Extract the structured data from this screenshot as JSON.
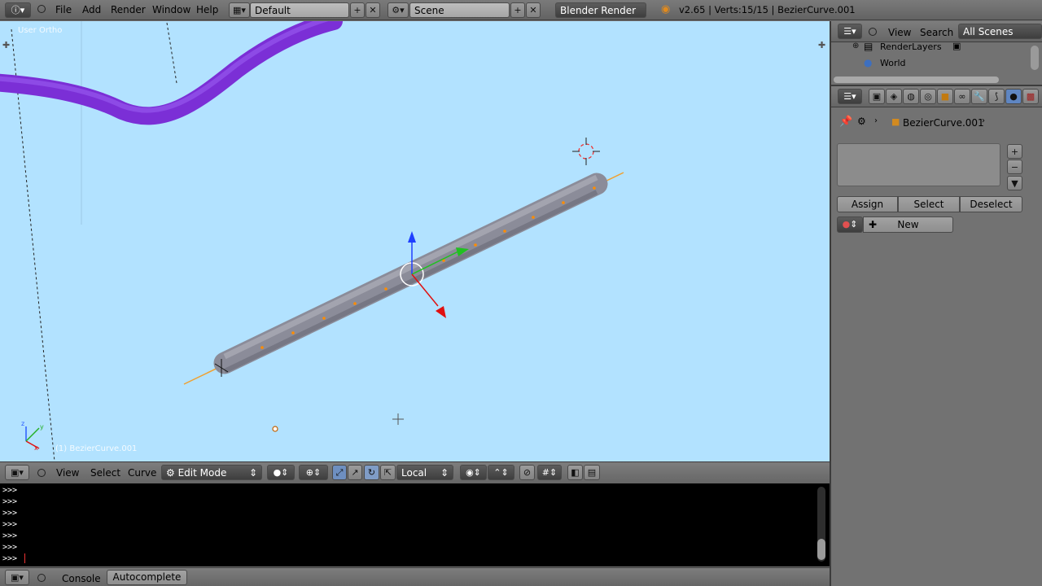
{
  "topbar": {
    "menus": [
      "File",
      "Add",
      "Render",
      "Window",
      "Help"
    ],
    "screen_layout": "Default",
    "scene": "Scene",
    "render_engine": "Blender Render",
    "status": "v2.65 | Verts:15/15 | BezierCurve.001"
  },
  "viewport": {
    "view_label": "User Ortho",
    "object_label": "(1) BezierCurve.001",
    "colors": {
      "background": "#b2e2ff",
      "curve": "#8a2be2",
      "tube": "#8c8c9a",
      "handle": "#f39c12"
    }
  },
  "viewport_header": {
    "menus": [
      "View",
      "Select",
      "Curve"
    ],
    "mode": "Edit Mode",
    "pivot": "Local"
  },
  "console": {
    "prompt": ">>>",
    "lines": [
      ">>>",
      ">>>",
      ">>>",
      ">>>",
      ">>>",
      ">>>",
      ">>>"
    ]
  },
  "console_header": {
    "menu": "Console",
    "button": "Autocomplete"
  },
  "outliner": {
    "menus": [
      "View",
      "Search"
    ],
    "filter": "All Scenes",
    "items": [
      "RenderLayers",
      "World"
    ]
  },
  "properties": {
    "object_name": "BezierCurve.001",
    "buttons": [
      "Assign",
      "Select",
      "Deselect"
    ],
    "new_label": "New"
  }
}
